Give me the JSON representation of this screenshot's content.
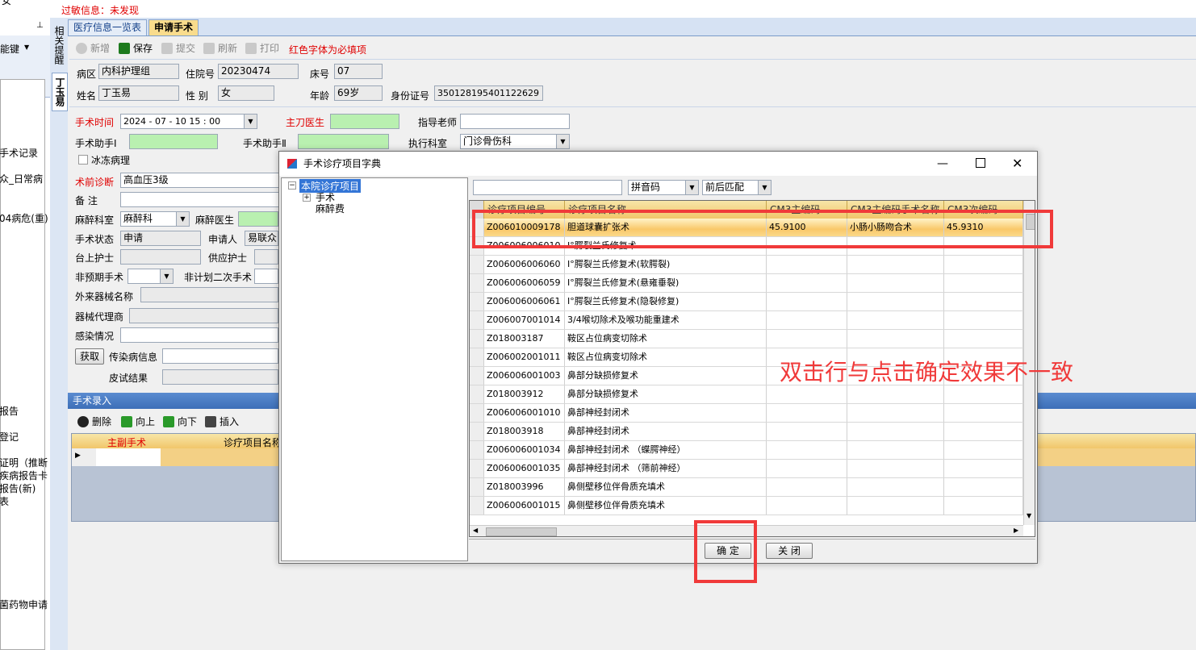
{
  "top": {
    "warning_label": "过敏信息：未发现",
    "corner_text": "女",
    "pin": "⊥"
  },
  "left": {
    "shortcut_label": "能键",
    "items": [
      "手术记录",
      "众_日常病",
      "04病危(重)",
      "报告",
      "登记",
      "证明（推断",
      "疾病报告卡",
      "报告(新)",
      "表",
      "菌药物申请"
    ]
  },
  "vtabs": {
    "top": "相关提醒",
    "patient": "丁玉易"
  },
  "tabs": [
    {
      "label": "医疗信息一览表"
    },
    {
      "label": "申请手术"
    }
  ],
  "toolbar": {
    "new": "新增",
    "save": "保存",
    "submit": "提交",
    "refresh": "刷新",
    "print": "打印",
    "required_note": "红色字体为必填项"
  },
  "patient": {
    "ward_label": "病区",
    "ward": "内科护理组",
    "admission_label": "住院号",
    "admission": "20230474",
    "bed_label": "床号",
    "bed": "07",
    "name_label": "姓名",
    "name": "丁玉易",
    "sex_label": "性 别",
    "sex": "女",
    "age_label": "年龄",
    "age": "69岁",
    "id_label": "身份证号",
    "id": "350128195401122629"
  },
  "form": {
    "time_label": "手术时间",
    "time": "2024 - 07 - 10   15 : 00",
    "surgeon_label": "主刀医生",
    "mentor_label": "指导老师",
    "assist1_label": "手术助手Ⅰ",
    "assist2_label": "手术助手Ⅱ",
    "dept_label": "执行科室",
    "dept": "门诊骨伤科",
    "frozen_label": "冰冻病理",
    "dx_label": "术前诊断",
    "dx": "高血压3级",
    "note_label": "备  注",
    "anes_dept_label": "麻醉科室",
    "anes_dept": "麻醉科",
    "anes_doc_label": "麻醉医生",
    "status_label": "手术状态",
    "status": "申请",
    "applicant_label": "申请人",
    "applicant": "易联众",
    "nurse_label": "台上护士",
    "supply_label": "供应护士",
    "unplanned_label": "非预期手术",
    "second_label": "非计划二次手术",
    "device_label": "外来器械名称",
    "agent_label": "器械代理商",
    "infection_label": "感染情况",
    "get_btn": "获取",
    "contagious_label": "传染病信息",
    "skin_label": "皮试结果"
  },
  "entry": {
    "header": "手术录入",
    "delete": "删除",
    "up": "向上",
    "down": "向下",
    "insert": "插入",
    "col_main": "主副手术",
    "col_name": "诊疗项目名称"
  },
  "dialog": {
    "title": "手术诊疗项目字典",
    "tree": {
      "root": "本院诊疗项目",
      "child1": "手术",
      "child2": "麻醉费"
    },
    "search_value": "",
    "mode": "拼音码",
    "match": "前后匹配",
    "columns": [
      "诊疗项目编号",
      "诊疗项目名称",
      "CM3主编码",
      "CM3主编码手术名称",
      "CM3次编码"
    ],
    "rows": [
      {
        "code": "Z006010009178",
        "name": "胆道球囊扩张术",
        "cm3": "45.9100",
        "cm3name": "小肠小肠吻合术",
        "cm3b": "45.9310"
      },
      {
        "code": "Z006006006010",
        "name": "Ⅰ°腭裂兰氏修复术",
        "cm3": "",
        "cm3name": "",
        "cm3b": ""
      },
      {
        "code": "Z006006006060",
        "name": "Ⅰ°腭裂兰氏修复术(软腭裂)",
        "cm3": "",
        "cm3name": "",
        "cm3b": ""
      },
      {
        "code": "Z006006006059",
        "name": "Ⅰ°腭裂兰氏修复术(悬雍垂裂)",
        "cm3": "",
        "cm3name": "",
        "cm3b": ""
      },
      {
        "code": "Z006006006061",
        "name": "Ⅰ°腭裂兰氏修复术(隐裂修复)",
        "cm3": "",
        "cm3name": "",
        "cm3b": ""
      },
      {
        "code": "Z006007001014",
        "name": "3/4喉切除术及喉功能重建术",
        "cm3": "",
        "cm3name": "",
        "cm3b": ""
      },
      {
        "code": "Z018003187",
        "name": "鞍区占位病变切除术",
        "cm3": "",
        "cm3name": "",
        "cm3b": ""
      },
      {
        "code": "Z006002001011",
        "name": "鞍区占位病变切除术",
        "cm3": "",
        "cm3name": "",
        "cm3b": ""
      },
      {
        "code": "Z006006001003",
        "name": "鼻部分缺损修复术",
        "cm3": "",
        "cm3name": "",
        "cm3b": ""
      },
      {
        "code": "Z018003912",
        "name": "鼻部分缺损修复术",
        "cm3": "",
        "cm3name": "",
        "cm3b": ""
      },
      {
        "code": "Z006006001010",
        "name": "鼻部神经封闭术",
        "cm3": "",
        "cm3name": "",
        "cm3b": ""
      },
      {
        "code": "Z018003918",
        "name": "鼻部神经封闭术",
        "cm3": "",
        "cm3name": "",
        "cm3b": ""
      },
      {
        "code": "Z006006001034",
        "name": "鼻部神经封闭术      （蝶腭神经）",
        "cm3": "",
        "cm3name": "",
        "cm3b": ""
      },
      {
        "code": "Z006006001035",
        "name": "鼻部神经封闭术      （筛前神经）",
        "cm3": "",
        "cm3name": "",
        "cm3b": ""
      },
      {
        "code": "Z018003996",
        "name": "鼻侧壁移位伴骨质充填术",
        "cm3": "",
        "cm3name": "",
        "cm3b": ""
      },
      {
        "code": "Z006006001015",
        "name": "鼻侧壁移位伴骨质充填术",
        "cm3": "",
        "cm3name": "",
        "cm3b": ""
      }
    ],
    "ok": "确 定",
    "close": "关 闭"
  },
  "annotation": "双击行与点击确定效果不一致",
  "colors": {
    "accent": "#f9dc8c",
    "required": "#e00000",
    "annotation": "#f03a3a"
  }
}
